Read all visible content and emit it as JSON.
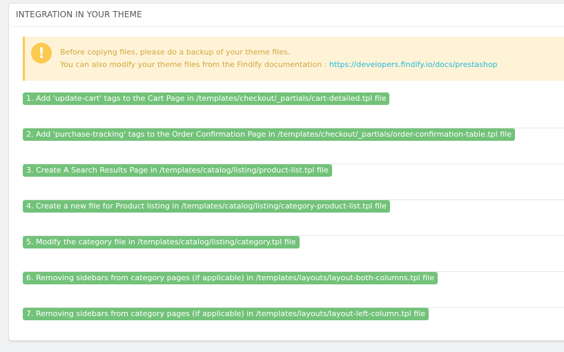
{
  "panel": {
    "title": "INTEGRATION IN YOUR THEME"
  },
  "alert": {
    "icon": "exclamation-icon",
    "line1": "Before copiyng files, please do a backup of your theme files.",
    "line2_text": "You can also modify your theme files from the Findify documentation : ",
    "link_text": "https://developers.findify.io/docs/prestashop"
  },
  "steps": [
    "1. Add 'update-cart' tags to the Cart Page in /templates/checkout/_partials/cart-detailed.tpl file",
    "2. Add 'purchase-tracking' tags to the Order Confirmation Page in /templates/checkout/_partials/order-confirmation-table.tpl file",
    "3. Create A Search Results Page in /templates/catalog/listing/product-list.tpl file",
    "4. Create a new file for Product listing in /templates/catalog/listing/category-product-list.tpl file",
    "5. Modify the category file in /templates/catalog/listing/category.tpl file",
    "6. Removing sidebars from category pages (if applicable) in /templates/layouts/layout-both-columns.tpl file",
    "7. Removing sidebars from category pages (if applicable) in /templates/layouts/layout-left-column.tpl file"
  ],
  "colors": {
    "step_label_bg": "#72c279",
    "alert_bg": "#fff3d7",
    "alert_text": "#d2a63c",
    "link": "#25b9d7"
  }
}
